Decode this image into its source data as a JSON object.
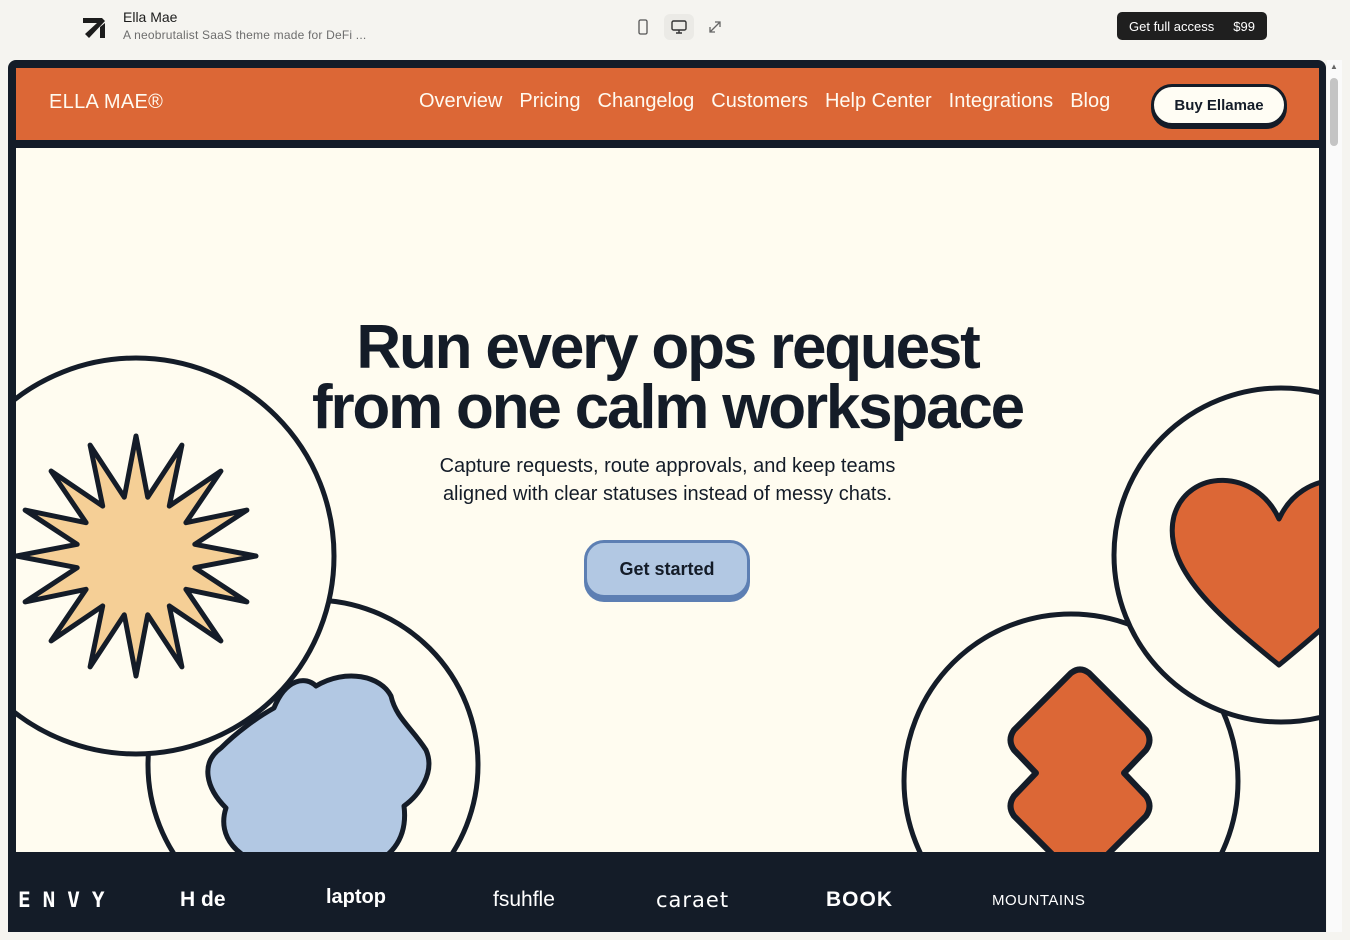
{
  "preview": {
    "title": "Ella Mae",
    "subtitle": "A neobrutalist SaaS theme made for DeFi ...",
    "buy_label": "Get full access",
    "price": "$99",
    "icons": [
      "mobile-icon",
      "desktop-icon",
      "expand-icon"
    ]
  },
  "site": {
    "brand": "ELLA MAE®",
    "nav": [
      "Overview",
      "Pricing",
      "Changelog",
      "Customers",
      "Help Center",
      "Integrations",
      "Blog"
    ],
    "cta": "Buy Ellamae"
  },
  "hero": {
    "headline_1": "Run every ops request",
    "headline_2": "from one calm workspace",
    "sub_1": "Capture requests, route approvals, and keep teams",
    "sub_2": "aligned with clear statuses instead of messy chats.",
    "button": "Get started"
  },
  "logos": [
    "ENVY",
    "H de",
    "laptop",
    "fsuhfle",
    "caraet",
    "BOOK",
    "MOUNTAINS"
  ],
  "colors": {
    "accent": "#dc6736",
    "dark": "#141c28",
    "cream": "#fffcf0",
    "blue": "#b2c8e3",
    "sun": "#f5cf96"
  }
}
